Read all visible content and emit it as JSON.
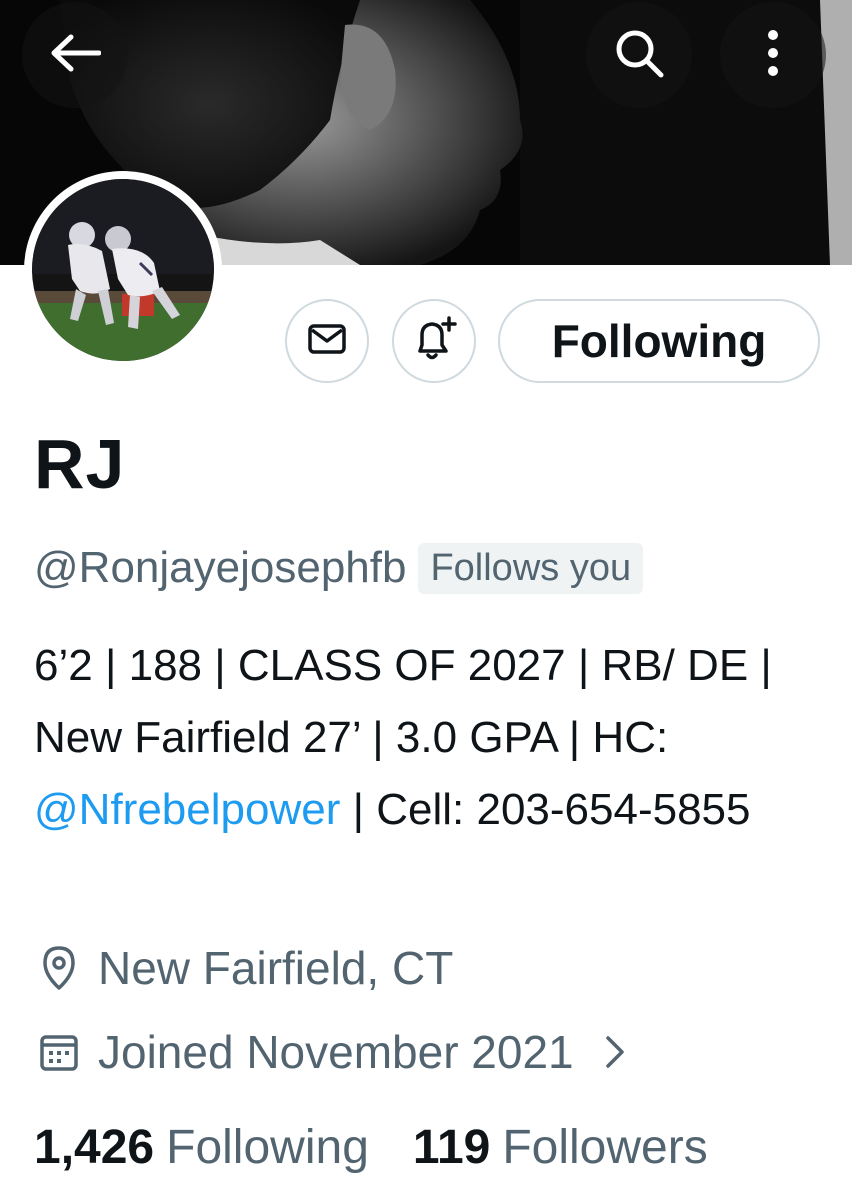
{
  "profile": {
    "name": "RJ",
    "handle": "@Ronjayejosephfb",
    "follows_you_badge": "Follows you",
    "bio": {
      "part1": "6’2 | 188 | CLASS OF 2027 | RB/ DE | New Fairfield 27’ | 3.0 GPA | HC: ",
      "mention": "@Nfrebelpower",
      "part2": " | Cell: 203-654-5855"
    },
    "location": "New Fairfield, CT",
    "joined": "Joined November 2021"
  },
  "actions": {
    "following_button": "Following",
    "message_icon": "envelope-icon",
    "notify_icon": "bell-plus-icon"
  },
  "header_icons": {
    "back": "arrow-left-icon",
    "search": "search-icon",
    "more": "more-vertical-icon"
  },
  "stats": {
    "following_count": "1,426",
    "following_label": "Following",
    "followers_count": "119",
    "followers_label": "Followers"
  },
  "colors": {
    "link": "#1d9bf0",
    "secondary_text": "#536471",
    "primary_text": "#0f1419",
    "border": "#cfd9de"
  }
}
